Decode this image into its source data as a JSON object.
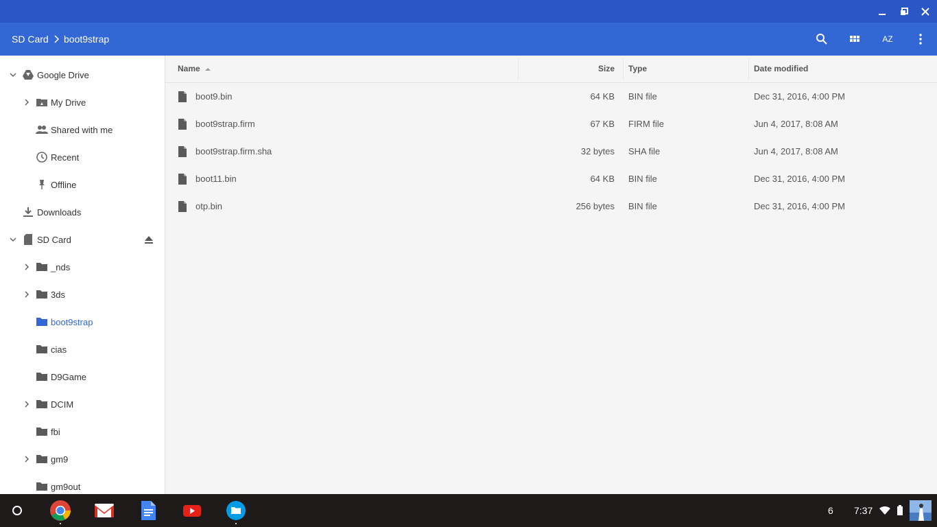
{
  "breadcrumb": {
    "root": "SD Card",
    "current": "boot9strap"
  },
  "toolbar": {
    "sort_label": "AZ"
  },
  "sidebar": {
    "google_drive": "Google Drive",
    "my_drive": "My Drive",
    "shared_with_me": "Shared with me",
    "recent": "Recent",
    "offline": "Offline",
    "downloads": "Downloads",
    "sd_card": "SD Card",
    "folders": [
      "_nds",
      "3ds",
      "boot9strap",
      "cias",
      "D9Game",
      "DCIM",
      "fbi",
      "gm9",
      "gm9out"
    ],
    "selected": "boot9strap"
  },
  "columns": {
    "name": "Name",
    "size": "Size",
    "type": "Type",
    "date": "Date modified"
  },
  "files": [
    {
      "name": "boot9.bin",
      "size": "64 KB",
      "type": "BIN file",
      "date": "Dec 31, 2016, 4:00 PM"
    },
    {
      "name": "boot9strap.firm",
      "size": "67 KB",
      "type": "FIRM file",
      "date": "Jun 4, 2017, 8:08 AM"
    },
    {
      "name": "boot9strap.firm.sha",
      "size": "32 bytes",
      "type": "SHA file",
      "date": "Jun 4, 2017, 8:08 AM"
    },
    {
      "name": "boot11.bin",
      "size": "64 KB",
      "type": "BIN file",
      "date": "Dec 31, 2016, 4:00 PM"
    },
    {
      "name": "otp.bin",
      "size": "256 bytes",
      "type": "BIN file",
      "date": "Dec 31, 2016, 4:00 PM"
    }
  ],
  "tray": {
    "notification_count": "6",
    "time": "7:37"
  },
  "colors": {
    "titlebar": "#2a56c6",
    "toolbar": "#3367d6",
    "accent": "#3367d6",
    "shelf": "#1e1a1a"
  }
}
